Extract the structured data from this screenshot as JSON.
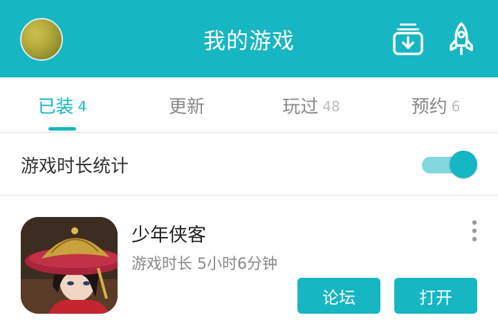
{
  "header": {
    "title": "我的游戏",
    "background_color": "#17b6c3",
    "icons": [
      "avatar",
      "download-box-icon",
      "rocket-icon"
    ]
  },
  "tabs": [
    {
      "label": "已装",
      "count": "4",
      "active": true
    },
    {
      "label": "更新",
      "count": "",
      "active": false
    },
    {
      "label": "玩过",
      "count": "48",
      "active": false
    },
    {
      "label": "预约",
      "count": "6",
      "active": false
    }
  ],
  "stats": {
    "label": "游戏时长统计",
    "toggle_on": true
  },
  "games": [
    {
      "name": "少年侠客",
      "playtime": "游戏时长 5小时6分钟",
      "forum_label": "论坛",
      "open_label": "打开"
    }
  ],
  "accent_color": "#17b6c3"
}
